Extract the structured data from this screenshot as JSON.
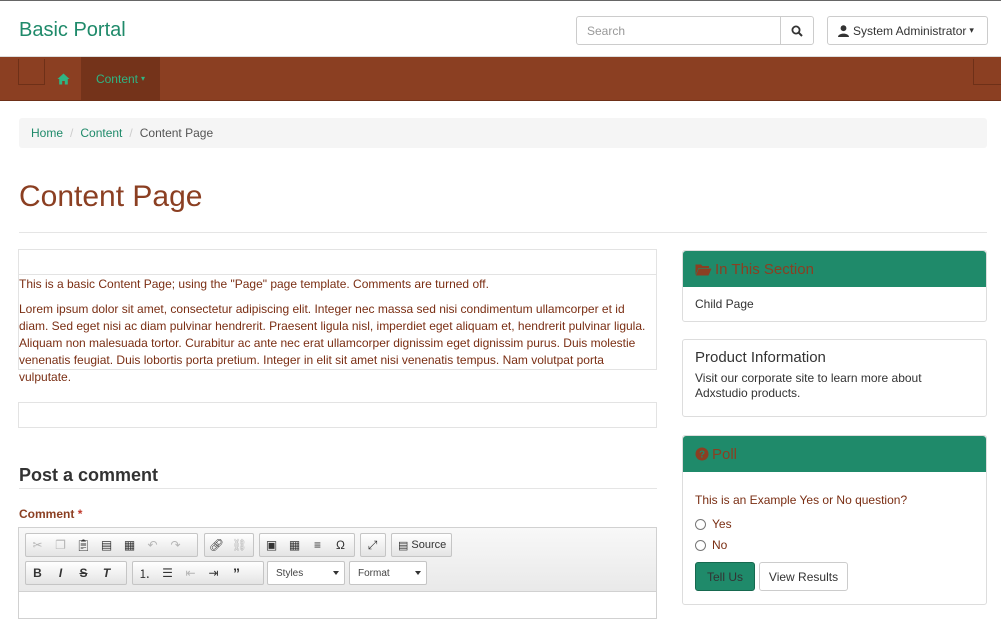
{
  "header": {
    "brand": "Basic Portal",
    "search_placeholder": "Search",
    "user_label": "System Administrator"
  },
  "nav": {
    "home_icon": "home-icon",
    "content_label": "Content"
  },
  "breadcrumb": {
    "items": [
      "Home",
      "Content"
    ],
    "active": "Content Page"
  },
  "page": {
    "title": "Content Page",
    "intro": "This is a basic Content Page; using the \"Page\" page template. Comments are turned off.",
    "body": "Lorem ipsum dolor sit amet, consectetur adipiscing elit. Integer nec massa sed nisi condimentum ullamcorper et id diam. Sed eget nisi ac diam pulvinar hendrerit. Praesent ligula nisl, imperdiet eget aliquam et, hendrerit pulvinar ligula. Aliquam non malesuada tortor. Curabitur ac ante nec erat ullamcorper dignissim eget dignissim purus. Duis molestie venenatis feugiat. Duis lobortis porta pretium. Integer in elit sit amet nisi venenatis tempus. Nam volutpat porta vulputate."
  },
  "comment": {
    "heading": "Post a comment",
    "label": "Comment",
    "required_mark": "*",
    "toolbar": {
      "source_label": "Source",
      "styles_label": "Styles",
      "format_label": "Format"
    }
  },
  "sidebar": {
    "section": {
      "title": "In This Section",
      "items": [
        "Child Page"
      ]
    },
    "product": {
      "title": "Product Information",
      "text": "Visit our corporate site to learn more about Adxstudio products."
    },
    "poll": {
      "title": "Poll",
      "question": "This is an Example Yes or No question?",
      "options": [
        "Yes",
        "No"
      ],
      "submit_label": "Tell Us",
      "results_label": "View Results"
    }
  },
  "colors": {
    "brand_green": "#1f8a6a",
    "nav_brown": "#8b3f22",
    "text_brown": "#7a2e13"
  }
}
